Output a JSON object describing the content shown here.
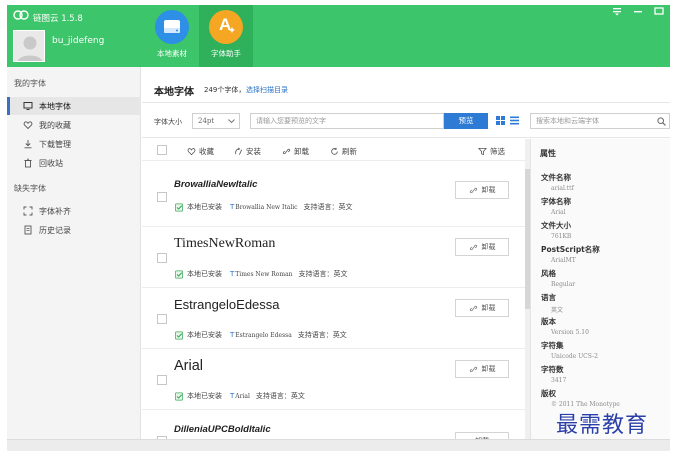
{
  "app": {
    "title": "链图云 1.5.8",
    "username": "bu_jidefeng"
  },
  "nav": [
    {
      "label": "本地素材",
      "icon": "hard-drive-icon"
    },
    {
      "label": "字体助手",
      "icon": "font-a-icon",
      "glyph": "A"
    }
  ],
  "colors": {
    "brand_green": "#3cc56a",
    "link_blue": "#2b73c8",
    "button_blue": "#2e7bd6"
  },
  "sidebar": {
    "my_fonts_title": "我的字体",
    "items": [
      {
        "label": "本地字体",
        "icon": "monitor-icon",
        "active": true
      },
      {
        "label": "我的收藏",
        "icon": "heart-icon"
      },
      {
        "label": "下载管理",
        "icon": "download-icon"
      },
      {
        "label": "回收站",
        "icon": "trash-icon"
      }
    ],
    "missing_title": "缺失字体",
    "missing_items": [
      {
        "label": "字体补齐",
        "icon": "expand-icon"
      },
      {
        "label": "历史记录",
        "icon": "document-icon"
      }
    ]
  },
  "main": {
    "title": "本地字体",
    "count": "249个字体，",
    "scan_link": "选择扫描目录",
    "toolbar": {
      "size_label": "字体大小",
      "size_value": "24pt",
      "preview_placeholder": "请输入您要预览的文字",
      "preview_button": "预览",
      "search_placeholder": "搜索本地和云端字体"
    },
    "actions": {
      "favorite": "收藏",
      "install": "安装",
      "uninstall": "卸载",
      "refresh": "刷新",
      "filter": "筛选"
    },
    "fonts": [
      {
        "name": "BrowalliaNewItalic",
        "status": "本地已安装",
        "font_id": "Browallia New Italic",
        "lang": "支持语言：英文",
        "action": "卸载"
      },
      {
        "name": "TimesNewRoman",
        "status": "本地已安装",
        "font_id": "Times New Roman",
        "lang": "支持语言：英文",
        "action": "卸载"
      },
      {
        "name": "EstrangeloEdessa",
        "status": "本地已安装",
        "font_id": "Estrangelo Edessa",
        "lang": "支持语言：英文",
        "action": "卸载"
      },
      {
        "name": "Arial",
        "status": "本地已安装",
        "font_id": "Arial",
        "lang": "支持语言：英文",
        "action": "卸载"
      },
      {
        "name": "DilleniaUPCBoldItalic",
        "status": "",
        "font_id": "",
        "lang": "",
        "action": "卸载"
      }
    ]
  },
  "properties": {
    "title": "属性",
    "items": [
      {
        "key": "文件名称",
        "value": "arial.ttf"
      },
      {
        "key": "字体名称",
        "value": "Arial"
      },
      {
        "key": "文件大小",
        "value": "761KB"
      },
      {
        "key": "PostScript名称",
        "value": "ArialMT"
      },
      {
        "key": "风格",
        "value": "Regular"
      },
      {
        "key": "语言",
        "value": "英文"
      },
      {
        "key": "版本",
        "value": "Version 5.10"
      },
      {
        "key": "字符集",
        "value": "Unicode UCS-2"
      },
      {
        "key": "字符数",
        "value": "3417"
      },
      {
        "key": "版权",
        "value": "© 2011 The Monotype"
      }
    ]
  },
  "watermark": "最需教育"
}
